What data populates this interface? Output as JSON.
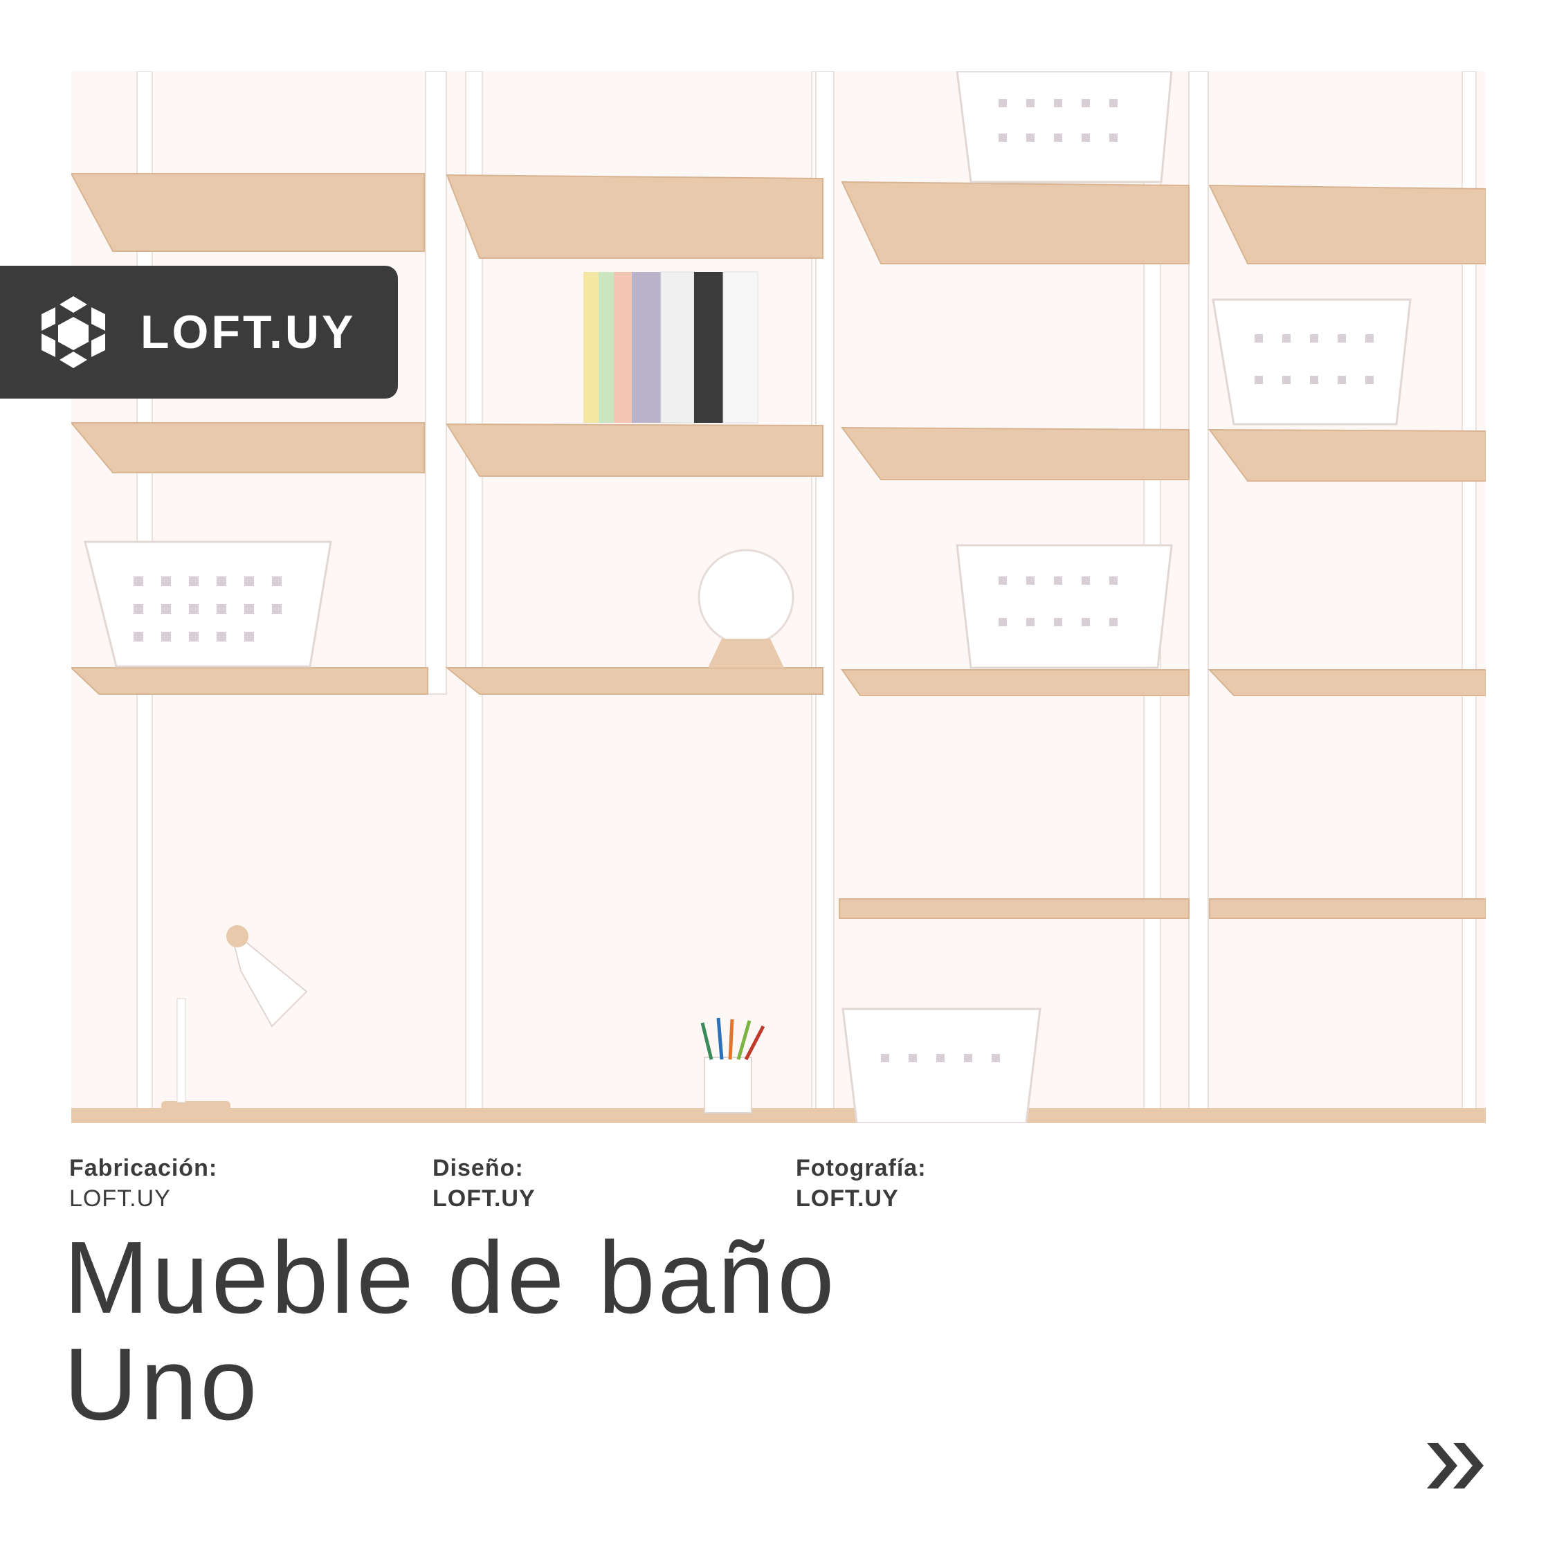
{
  "brand": {
    "name": "LOFT.UY",
    "color": "#3b3b3b",
    "logo_icon": "snowflake-cube-logo"
  },
  "credits": [
    {
      "label": "Fabricación:",
      "value": "LOFT.UY"
    },
    {
      "label": "Diseño:",
      "value": "LOFT.UY"
    },
    {
      "label": "Fotografía:",
      "value": "LOFT.UY"
    }
  ],
  "title": {
    "line1": "Mueble de baño",
    "line2": "Uno"
  },
  "navigation": {
    "next_icon": "double-chevron-right-icon"
  },
  "colors": {
    "wood": "#e8c9ab",
    "wall": "#fbf4f1",
    "frame": "#ffffff",
    "text": "#3b3b3b"
  }
}
